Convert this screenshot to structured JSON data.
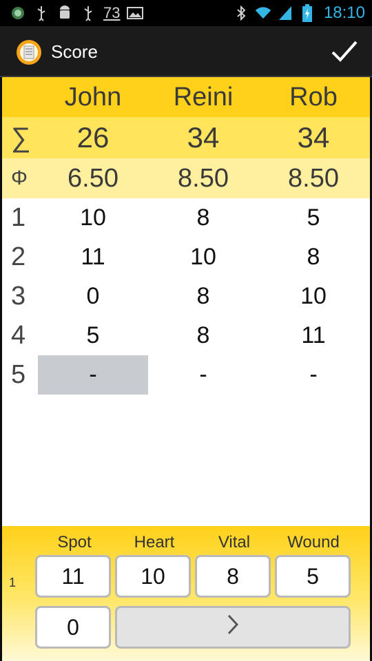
{
  "status_bar": {
    "notification_number": "73",
    "time": "18:10"
  },
  "action_bar": {
    "title": "Score",
    "done_icon": "checkmark-icon",
    "app_icon": "app-logo-icon"
  },
  "table": {
    "players": [
      "John",
      "Reini",
      "Rob"
    ],
    "sum_label": "∑",
    "sums": [
      "26",
      "34",
      "34"
    ],
    "avg_label": "Φ",
    "averages": [
      "6.50",
      "8.50",
      "8.50"
    ],
    "rows": [
      {
        "label": "1",
        "values": [
          "10",
          "8",
          "5"
        ]
      },
      {
        "label": "2",
        "values": [
          "11",
          "10",
          "8"
        ]
      },
      {
        "label": "3",
        "values": [
          "0",
          "8",
          "10"
        ]
      },
      {
        "label": "4",
        "values": [
          "5",
          "8",
          "11"
        ]
      },
      {
        "label": "5",
        "values": [
          "-",
          "-",
          "-"
        ]
      }
    ]
  },
  "entry_panel": {
    "row_number": "1",
    "headers": [
      "Spot",
      "Heart",
      "Vital",
      "Wound"
    ],
    "keys": [
      "11",
      "10",
      "8",
      "5"
    ],
    "zero_key": "0",
    "next_icon": "chevron-right-icon"
  }
}
